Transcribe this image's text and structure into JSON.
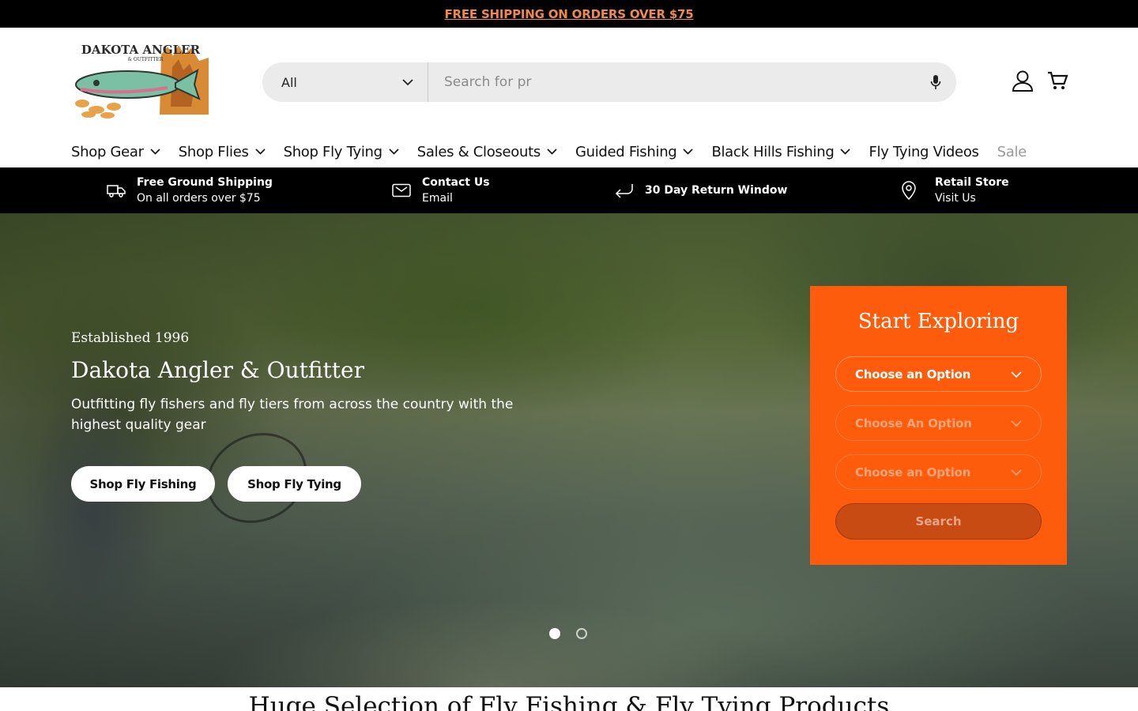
{
  "announcement": {
    "text": "FREE SHIPPING ON ORDERS OVER $75"
  },
  "logo": {
    "line1": "DAKOTA ANGLER",
    "line2": "& OUTFITTER"
  },
  "search": {
    "category": "All",
    "placeholder": "Search for pr"
  },
  "nav": [
    {
      "label": "Shop Gear",
      "dropdown": true
    },
    {
      "label": "Shop Flies",
      "dropdown": true
    },
    {
      "label": "Shop Fly Tying",
      "dropdown": true
    },
    {
      "label": "Sales & Closeouts",
      "dropdown": true
    },
    {
      "label": "Guided Fishing",
      "dropdown": true
    },
    {
      "label": "Black Hills Fishing",
      "dropdown": true
    },
    {
      "label": "Fly Tying Videos",
      "dropdown": false
    },
    {
      "label": "Sale",
      "dropdown": false
    }
  ],
  "usp": [
    {
      "icon": "truck-icon",
      "title": "Free Ground Shipping",
      "sub": "On all orders over $75"
    },
    {
      "icon": "envelope-icon",
      "title": "Contact Us",
      "sub": "Email"
    },
    {
      "icon": "return-arrow-icon",
      "title": "30 Day Return Window",
      "sub": ""
    },
    {
      "icon": "map-pin-icon",
      "title": "Retail Store",
      "sub": "Visit Us"
    }
  ],
  "hero": {
    "kicker": "Established 1996",
    "title": "Dakota Angler & Outfitter",
    "subtitle": "Outfitting fly fishers and fly tiers from across the country with the highest quality gear",
    "buttons": [
      "Shop Fly Fishing",
      "Shop Fly Tying"
    ],
    "slides_total": 2,
    "active_slide": 1
  },
  "finder": {
    "title": "Start Exploring",
    "selects": [
      "Choose an Option",
      "Choose An Option",
      "Choose an Option"
    ],
    "button": "Search",
    "accent": "#fc5c0c"
  },
  "section": {
    "heading": "Huge Selection of Fly Fishing & Fly Tying Products"
  },
  "colors": {
    "announcement_link": "#f08a4b",
    "finder_bg": "#fc5c0c"
  }
}
